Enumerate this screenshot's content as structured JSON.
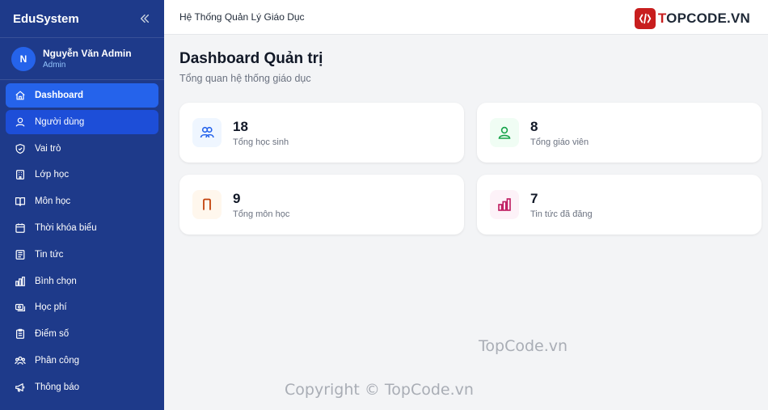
{
  "sidebar": {
    "brand": "EduSystem",
    "user": {
      "initial": "N",
      "name": "Nguyễn Văn Admin",
      "role": "Admin"
    },
    "items": [
      {
        "label": "Dashboard",
        "icon": "home-icon",
        "state": "active"
      },
      {
        "label": "Người dùng",
        "icon": "user-icon",
        "state": "hover"
      },
      {
        "label": "Vai trò",
        "icon": "shield-icon",
        "state": ""
      },
      {
        "label": "Lớp học",
        "icon": "building-icon",
        "state": ""
      },
      {
        "label": "Môn học",
        "icon": "book-icon",
        "state": ""
      },
      {
        "label": "Thời khóa biểu",
        "icon": "calendar-icon",
        "state": ""
      },
      {
        "label": "Tin tức",
        "icon": "newspaper-icon",
        "state": ""
      },
      {
        "label": "Bình chọn",
        "icon": "bar-chart-icon",
        "state": ""
      },
      {
        "label": "Học phí",
        "icon": "money-icon",
        "state": ""
      },
      {
        "label": "Điểm số",
        "icon": "clipboard-icon",
        "state": ""
      },
      {
        "label": "Phân công",
        "icon": "users-icon",
        "state": ""
      },
      {
        "label": "Thông báo",
        "icon": "megaphone-icon",
        "state": ""
      }
    ]
  },
  "header": {
    "title": "Hệ Thống Quản Lý Giáo Dục",
    "logo": {
      "prefix": "T",
      "suffix": "OPCODE.VN"
    }
  },
  "main": {
    "title": "Dashboard Quản trị",
    "subtitle": "Tổng quan hệ thống giáo dục",
    "stats": [
      {
        "value": "18",
        "label": "Tổng học sinh",
        "icon": "students-icon",
        "color": "#2563eb",
        "bg": "#eff6ff"
      },
      {
        "value": "8",
        "label": "Tổng giáo viên",
        "icon": "teacher-icon",
        "color": "#16a34a",
        "bg": "#f0fdf4"
      },
      {
        "value": "9",
        "label": "Tổng môn học",
        "icon": "subject-icon",
        "color": "#c2410c",
        "bg": "#fff7ed"
      },
      {
        "value": "7",
        "label": "Tin tức đã đăng",
        "icon": "news-chart-icon",
        "color": "#be185d",
        "bg": "#fdf2f8"
      }
    ]
  },
  "watermarks": {
    "center": "TopCode.vn",
    "bottom": "Copyright © TopCode.vn"
  },
  "colors": {
    "sidebar": "#1e3a8a",
    "accent": "#2563eb",
    "background": "#f3f4f6"
  }
}
